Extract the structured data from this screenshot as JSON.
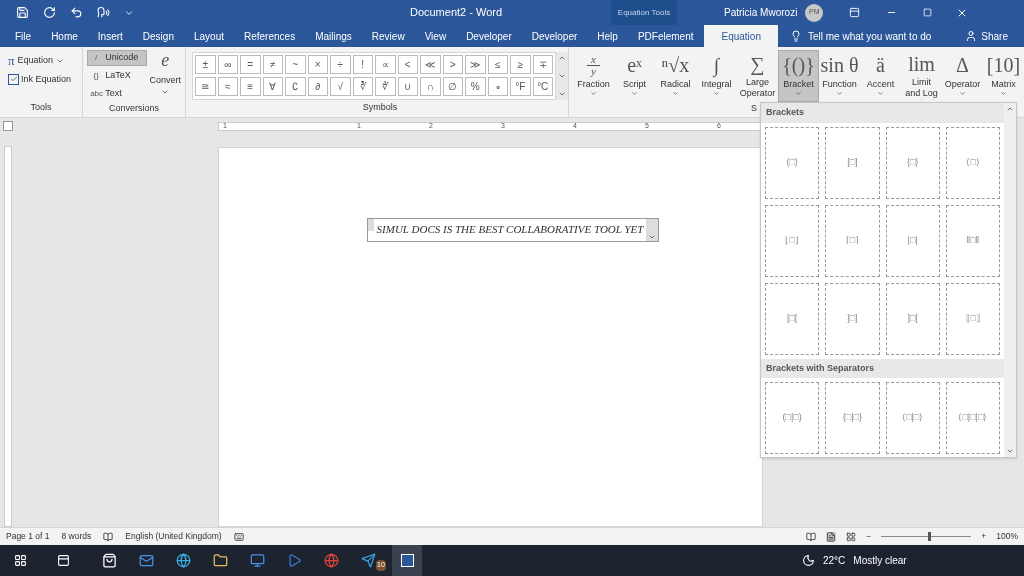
{
  "title_bar": {
    "title": "Document2  -  Word",
    "context_tab": "Equation Tools",
    "user": "Patricia Mworozi",
    "avatar": "PM"
  },
  "tabs": [
    {
      "label": "File",
      "selected": false
    },
    {
      "label": "Home",
      "selected": false
    },
    {
      "label": "Insert",
      "selected": false
    },
    {
      "label": "Design",
      "selected": false
    },
    {
      "label": "Layout",
      "selected": false
    },
    {
      "label": "References",
      "selected": false
    },
    {
      "label": "Mailings",
      "selected": false
    },
    {
      "label": "Review",
      "selected": false
    },
    {
      "label": "View",
      "selected": false
    },
    {
      "label": "Developer",
      "selected": false
    },
    {
      "label": "Developer",
      "selected": false
    },
    {
      "label": "Help",
      "selected": false
    },
    {
      "label": "PDFelement",
      "selected": false
    },
    {
      "label": "Equation",
      "selected": true
    }
  ],
  "tell_me": "Tell me what you want to do",
  "share": "Share",
  "ribbon": {
    "tools": {
      "label": "Tools",
      "equation_icon": "π",
      "equation": "Equation",
      "ink_equation": "Ink Equation"
    },
    "conversions": {
      "label": "Conversions",
      "options": [
        {
          "label": "Unicode",
          "icon": "/",
          "selected": true
        },
        {
          "label": "LaTeX",
          "icon": "{}",
          "selected": false
        },
        {
          "label": "Text",
          "icon": "abc",
          "selected": false
        }
      ],
      "convert_icon": "e",
      "convert": "Convert"
    },
    "symbols": {
      "label": "Symbols",
      "rows": [
        [
          "±",
          "∞",
          "=",
          "≠",
          "~",
          "×",
          "÷",
          "!",
          "∝",
          "<",
          "≪",
          ">",
          "≫",
          "≤",
          "≥",
          "∓"
        ],
        [
          "≅",
          "≈",
          "≡",
          "∀",
          "∁",
          "∂",
          "√",
          "∛",
          "∜",
          "∪",
          "∩",
          "∅",
          "%",
          "∘",
          "°F",
          "°C"
        ]
      ]
    },
    "structures": {
      "label": "S",
      "items": [
        {
          "label": "Fraction",
          "kind": "fraction",
          "numerator": "x",
          "denominator": "y",
          "selected": false
        },
        {
          "label": "Script",
          "glyph": "eˣ",
          "selected": false
        },
        {
          "label": "Radical",
          "glyph": "ⁿ√x",
          "selected": false
        },
        {
          "label": "Integral",
          "glyph": "∫",
          "selected": false
        },
        {
          "label": "Large Operator",
          "glyph": "∑",
          "selected": false
        },
        {
          "label": "Bracket",
          "glyph": "{()}",
          "selected": true
        },
        {
          "label": "Function",
          "glyph": "sin θ",
          "selected": false
        },
        {
          "label": "Accent",
          "glyph": "ä",
          "selected": false
        },
        {
          "label": "Limit and Log",
          "glyph": "lim",
          "selected": false
        },
        {
          "label": "Operator",
          "glyph": "Δ",
          "selected": false
        },
        {
          "label": "Matrix",
          "glyph": "[10]",
          "selected": false
        }
      ]
    }
  },
  "ruler": [
    "1",
    "1",
    "2",
    "3",
    "4",
    "5",
    "6"
  ],
  "document": {
    "equation": "SIMUL DOCS IS THE BEST COLLABORATIVE TOOL YET"
  },
  "gallery": {
    "sections": [
      {
        "title": "Brackets",
        "items": [
          "(□)",
          "[□]",
          "{□}",
          "⟨□⟩",
          "⌊□⌋",
          "⌈□⌉",
          "|□|",
          "‖□‖",
          "[□[",
          "]□]",
          "]□[",
          "⟦□⟧"
        ]
      },
      {
        "title": "Brackets with Separators",
        "items": [
          "(□|□)",
          "{□|□}",
          "⟨□|□⟩",
          "⟨□|□|□⟩"
        ]
      }
    ]
  },
  "status_bar": {
    "page": "Page 1 of 1",
    "words": "8 words",
    "language": "English (United Kingdom)",
    "zoom_minus": "−",
    "zoom_plus": "+",
    "zoom": {
      "level": 0.52
    },
    "zoom_label": "100%"
  },
  "taskbar": {
    "badge": "10",
    "temperature": "22°C",
    "weather": "Mostly clear"
  }
}
